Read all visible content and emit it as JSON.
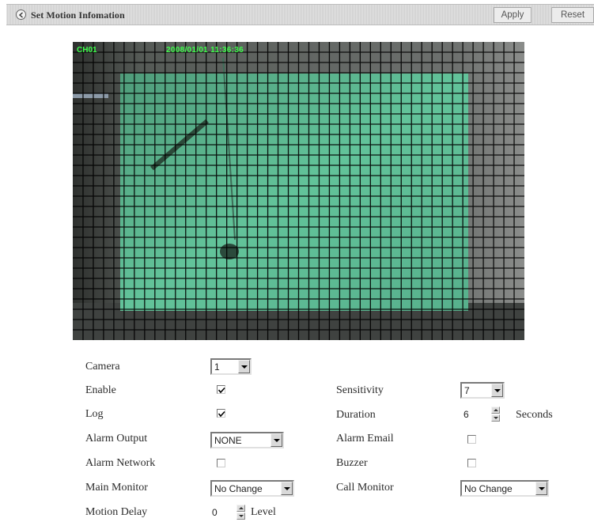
{
  "header": {
    "title": "Set Motion Infomation",
    "apply_label": "Apply",
    "reset_label": "Reset",
    "back_icon": "back-circle-arrow-icon"
  },
  "camera_view": {
    "channel": "CH01",
    "timestamp": "2008/01/01 11:36:36",
    "grid_color": "#000000",
    "region_color": "#5fc49a"
  },
  "form": {
    "camera": {
      "label": "Camera",
      "value": "1"
    },
    "enable": {
      "label": "Enable",
      "checked": true
    },
    "log": {
      "label": "Log",
      "checked": true
    },
    "alarm_output": {
      "label": "Alarm Output",
      "value": "NONE"
    },
    "alarm_network": {
      "label": "Alarm Network",
      "checked": false
    },
    "main_monitor": {
      "label": "Main Monitor",
      "value": "No Change"
    },
    "motion_delay": {
      "label": "Motion Delay",
      "value": "0",
      "unit": "Level"
    },
    "sensitivity": {
      "label": "Sensitivity",
      "value": "7"
    },
    "duration": {
      "label": "Duration",
      "value": "6",
      "unit": "Seconds"
    },
    "alarm_email": {
      "label": "Alarm Email",
      "checked": false
    },
    "buzzer": {
      "label": "Buzzer",
      "checked": false
    },
    "call_monitor": {
      "label": "Call Monitor",
      "value": "No Change"
    }
  }
}
